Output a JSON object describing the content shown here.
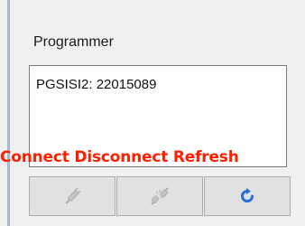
{
  "panel": {
    "title": "Programmer"
  },
  "programmer_list": {
    "items": [
      {
        "label": "PGSISI2: 22015089"
      }
    ]
  },
  "button_labels_text": "Connect Disconnect Refresh",
  "toolbar": {
    "buttons": [
      {
        "name": "Connect",
        "icon": "plug-connect-icon",
        "enabled": false
      },
      {
        "name": "Disconnect",
        "icon": "plug-disconnect-icon",
        "enabled": false
      },
      {
        "name": "Refresh",
        "icon": "refresh-icon",
        "enabled": true
      }
    ]
  },
  "colors": {
    "label_red": "#ff1f00",
    "refresh_blue": "#2a6fd6",
    "disabled_gray": "#b8b8b8"
  }
}
